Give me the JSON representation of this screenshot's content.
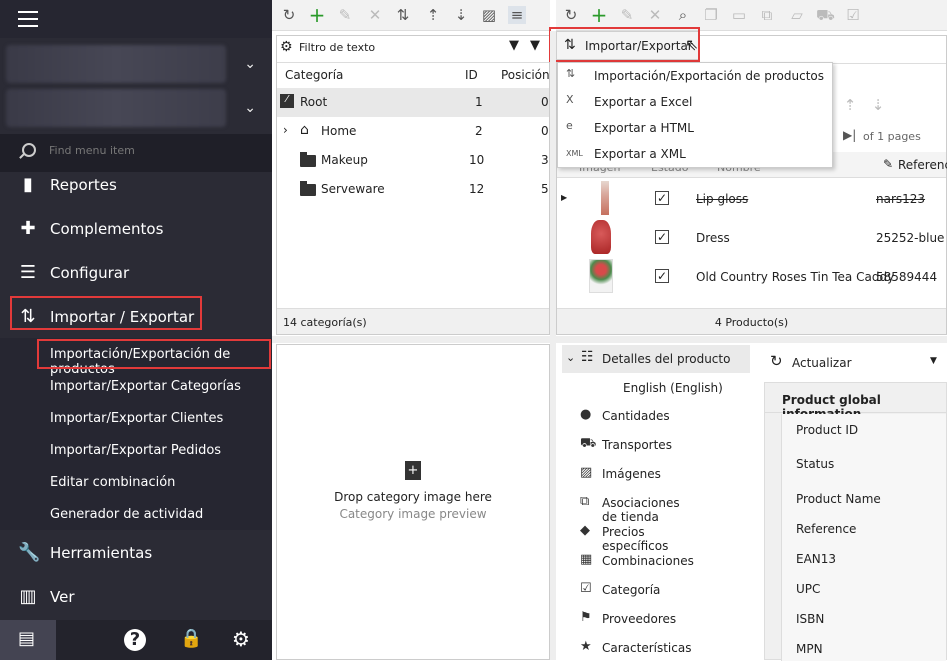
{
  "sidebar": {
    "search_placeholder": "Find menu item",
    "nav": [
      {
        "label": "Reportes",
        "icon": "bar-chart-icon"
      },
      {
        "label": "Complementos",
        "icon": "puzzle-icon"
      },
      {
        "label": "Configurar",
        "icon": "sliders-icon"
      },
      {
        "label": "Importar / Exportar",
        "icon": "import-export-icon"
      },
      {
        "label": "Herramientas",
        "icon": "wrench-icon"
      },
      {
        "label": "Ver",
        "icon": "view-icon"
      }
    ],
    "submenu": [
      "Importación/Exportación de productos",
      "Importar/Exportar Categorías",
      "Importar/Exportar Clientes",
      "Importar/Exportar Pedidos",
      "Editar combinación",
      "Generador de actividad"
    ],
    "bottom_icons": [
      "store-icon",
      "help-icon",
      "lock-icon",
      "gear-icon"
    ]
  },
  "categories": {
    "filter_placeholder": "Filtro de texto",
    "columns": {
      "category": "Categoría",
      "id": "ID",
      "position": "Posición"
    },
    "rows": [
      {
        "name": "Root",
        "id": "1",
        "pos": "0"
      },
      {
        "name": "Home",
        "id": "2",
        "pos": "0"
      },
      {
        "name": "Makeup",
        "id": "10",
        "pos": "3"
      },
      {
        "name": "Serveware",
        "id": "12",
        "pos": "5"
      }
    ],
    "footer": "14 categoría(s)",
    "drop_title": "Drop category image here",
    "drop_sub": "Category image preview"
  },
  "products": {
    "toolbar_menu_label": "Importar/Exportar",
    "dropdown": [
      {
        "label": "Importación/Exportación de productos",
        "icon": "import-export-icon"
      },
      {
        "label": "Exportar a Excel",
        "icon": "excel-icon"
      },
      {
        "label": "Exportar a HTML",
        "icon": "html-icon"
      },
      {
        "label": "Exportar a XML",
        "icon": "xml-icon"
      }
    ],
    "pages": "of 1 pages",
    "col_ref": "Referenci",
    "col_image": "Imagen",
    "col_state": "Estado",
    "col_name": "Nombre",
    "rows": [
      {
        "name": "Lip gloss",
        "ref": "nars123"
      },
      {
        "name": "Dress",
        "ref": "25252-blue"
      },
      {
        "name": "Old Country Roses Tin Tea Caddy",
        "ref": "58589444"
      }
    ],
    "footer": "4 Producto(s)"
  },
  "details": {
    "title": "Detalles del producto",
    "language": "English (English)",
    "items": [
      {
        "label": "Cantidades",
        "icon": "quantity-icon"
      },
      {
        "label": "Transportes",
        "icon": "truck-icon"
      },
      {
        "label": "Imágenes",
        "icon": "image-icon"
      },
      {
        "label": "Asociaciones de tienda",
        "icon": "store-assoc-icon"
      },
      {
        "label": "Precios específicos",
        "icon": "price-tag-icon"
      },
      {
        "label": "Combinaciones",
        "icon": "combinations-icon"
      },
      {
        "label": "Categoría",
        "icon": "category-icon"
      },
      {
        "label": "Proveedores",
        "icon": "supplier-icon"
      },
      {
        "label": "Características",
        "icon": "star-icon"
      }
    ]
  },
  "global_info": {
    "refresh": "Actualizar",
    "heading": "Product global information",
    "fields": [
      "Product ID",
      "Status",
      "Product Name",
      "Reference",
      "EAN13",
      "UPC",
      "ISBN",
      "MPN"
    ]
  }
}
